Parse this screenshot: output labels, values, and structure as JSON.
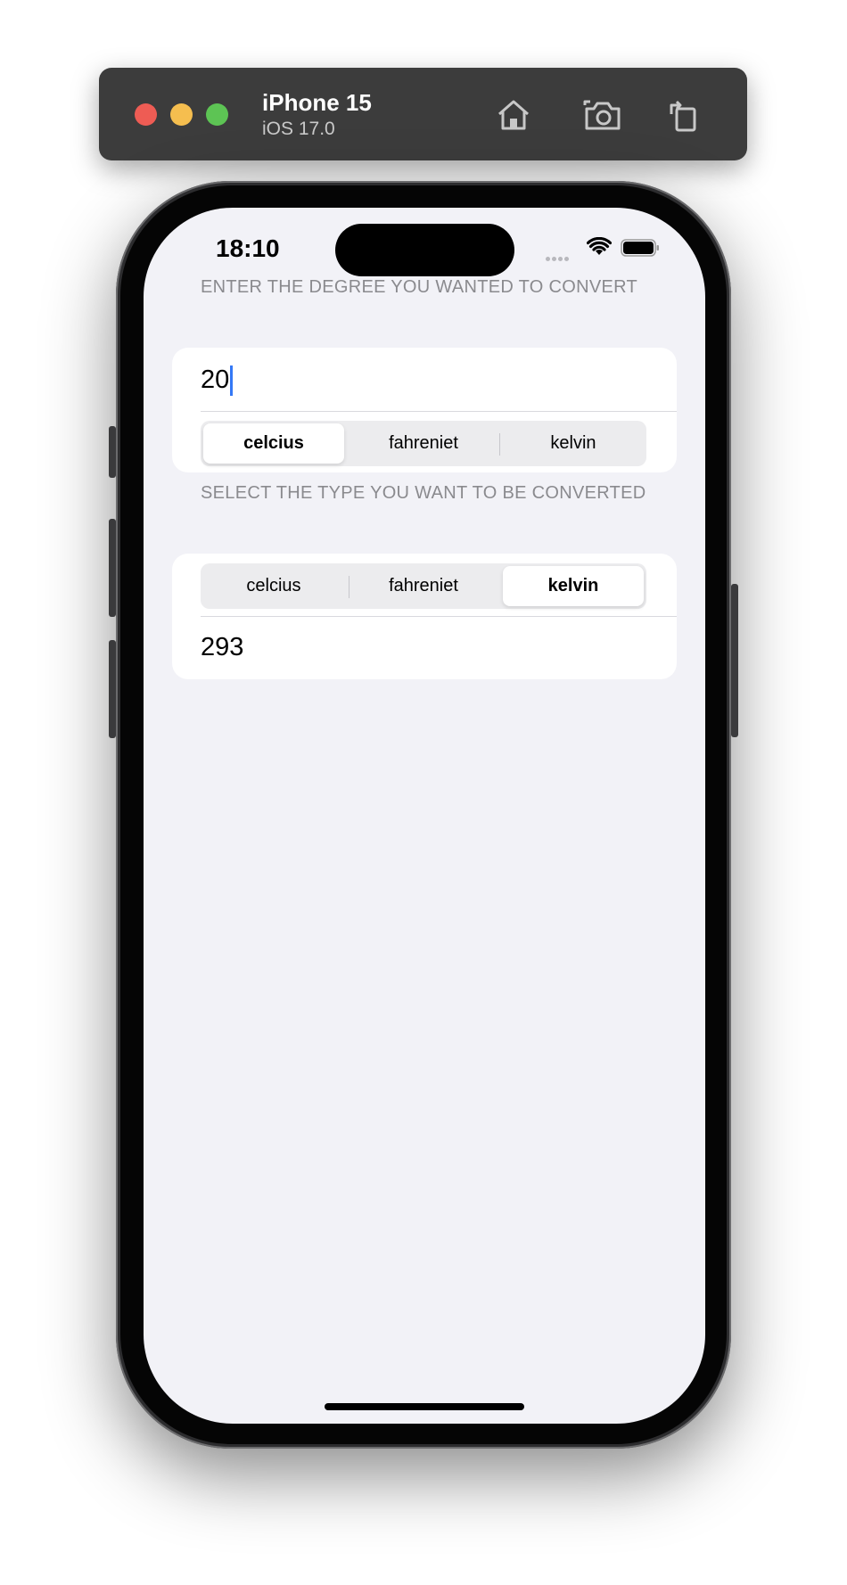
{
  "simulator": {
    "device_name": "iPhone 15",
    "os_version": "iOS 17.0",
    "tools": [
      "home-icon",
      "screenshot-icon",
      "rotate-icon"
    ]
  },
  "status_bar": {
    "time": "18:10"
  },
  "input_section": {
    "header": "ENTER THE DEGREE YOU WANTED TO CONVERT",
    "value": "20",
    "units": [
      "celcius",
      "fahreniet",
      "kelvin"
    ],
    "selected": "celcius"
  },
  "output_section": {
    "header": "SELECT THE TYPE YOU WANT TO BE CONVERTED",
    "units": [
      "celcius",
      "fahreniet",
      "kelvin"
    ],
    "selected": "kelvin",
    "result": "293"
  },
  "colors": {
    "background": "#f2f2f7",
    "card": "#ffffff",
    "caret": "#3478f6",
    "header_text": "#8a8a8e"
  }
}
